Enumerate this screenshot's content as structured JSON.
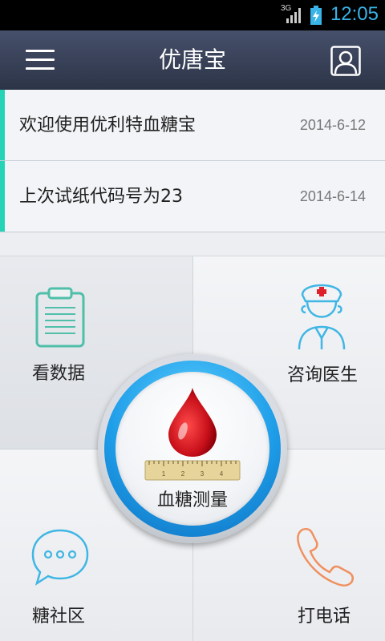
{
  "status_bar": {
    "network": "3G",
    "time": "12:05"
  },
  "header": {
    "title": "优唐宝",
    "menu_icon": "hamburger-menu-icon",
    "profile_icon": "user-profile-icon"
  },
  "news": [
    {
      "text": "欢迎使用优利特血糖宝",
      "date": "2014-6-12"
    },
    {
      "text": "上次试纸代码号为23",
      "date": "2014-6-14"
    }
  ],
  "grid": {
    "view_data": {
      "label": "看数据",
      "icon": "clipboard-icon"
    },
    "consult_doctor": {
      "label": "咨询医生",
      "icon": "nurse-icon"
    },
    "community": {
      "label": "糖社区",
      "icon": "chat-bubble-icon"
    },
    "call": {
      "label": "打电话",
      "icon": "phone-icon"
    }
  },
  "measure": {
    "label": "血糖测量",
    "icon": "blood-drop-icon",
    "ruler_ticks": [
      "1",
      "2",
      "3",
      "4"
    ]
  },
  "colors": {
    "accent": "#25d3b6",
    "header": "#3a4358",
    "time": "#39b4e8",
    "ring": "#1e9de8",
    "blood": "#c8101a"
  }
}
